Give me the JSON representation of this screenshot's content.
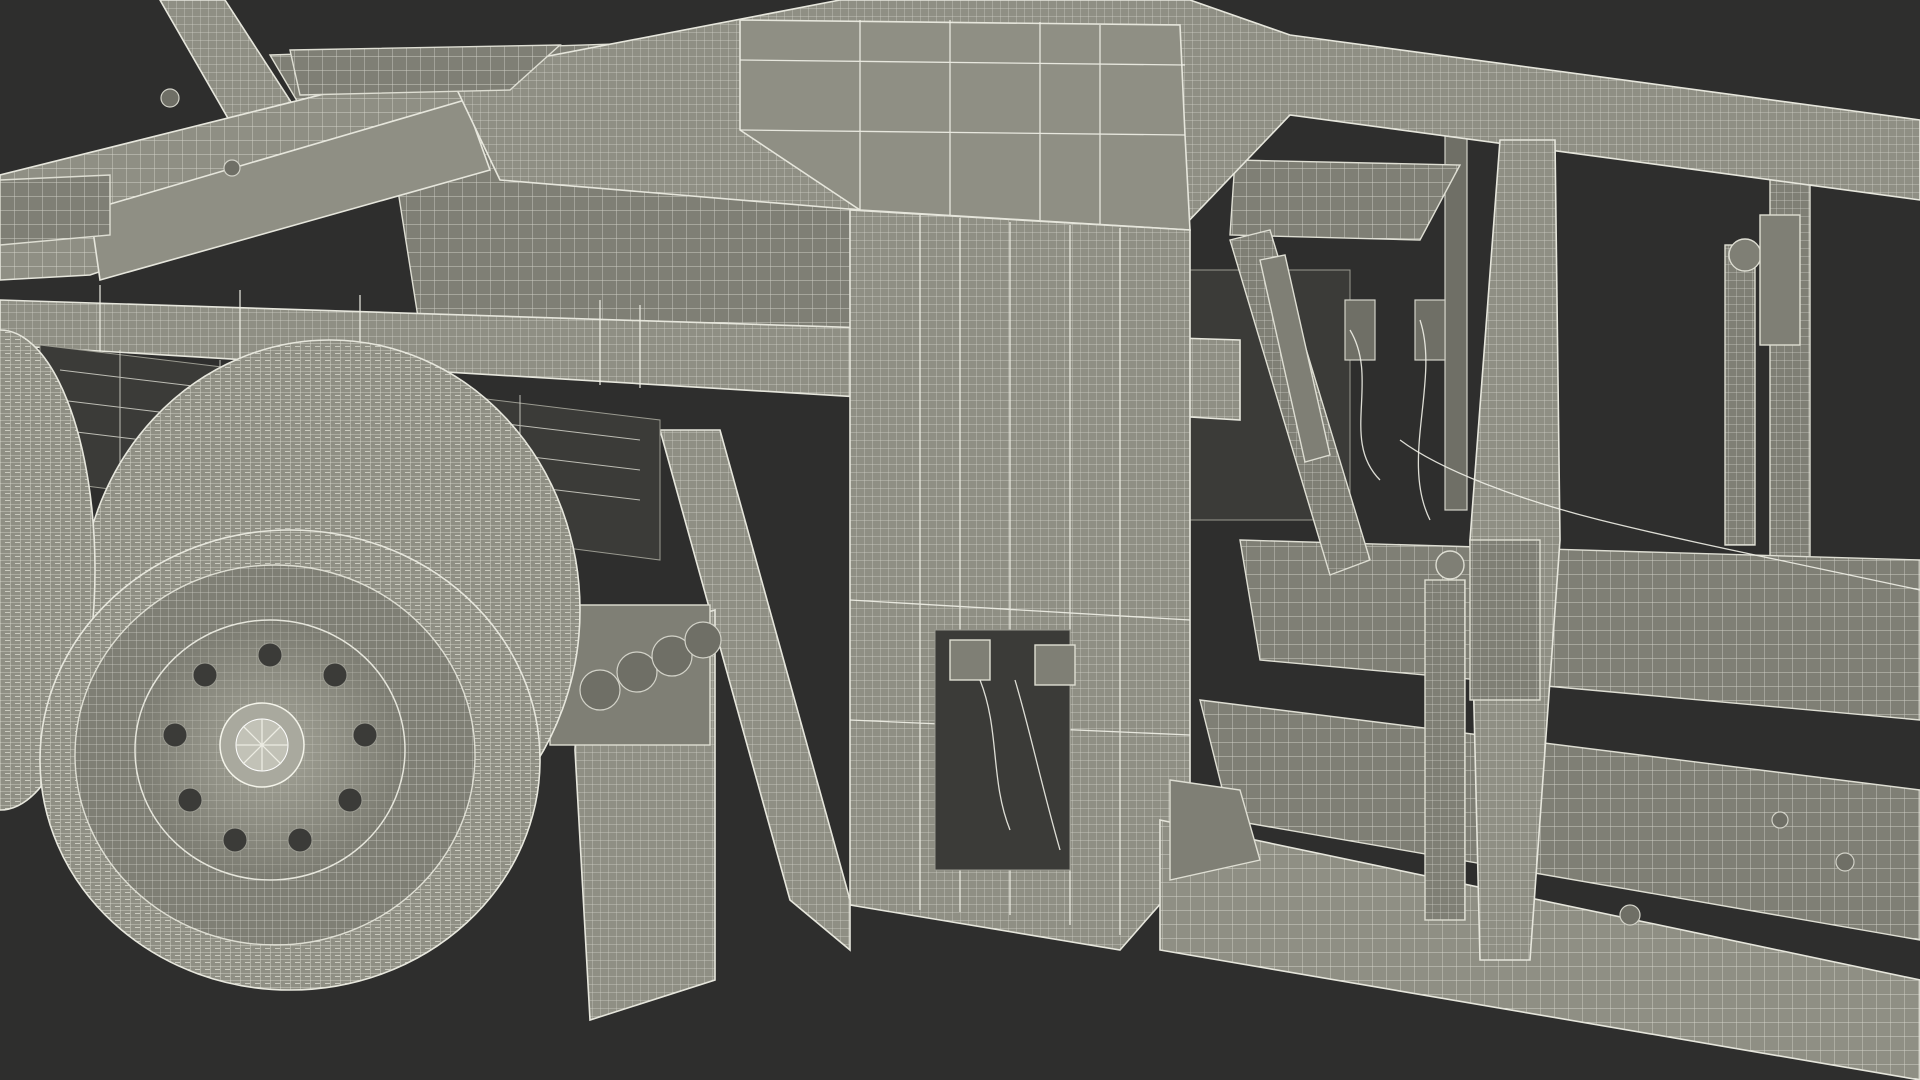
{
  "scene": {
    "subject": "car-transporter-trailer-wireframe",
    "render_style": "clay-with-wireframe",
    "colors": {
      "background": "#2e2e2d",
      "material": "#8f8f84",
      "material_shadow": "#6f6f66",
      "wire": "#e6e6dc"
    }
  }
}
